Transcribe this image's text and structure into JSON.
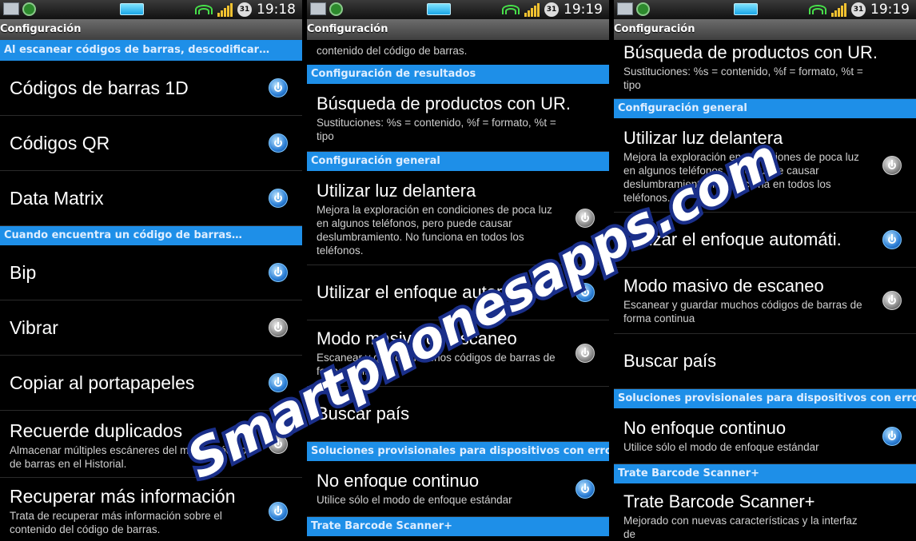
{
  "status": {
    "time": "19:18",
    "time2": "19:19",
    "cal": "31"
  },
  "title": "Configuración",
  "watermark": "Smartphonesapps.com",
  "panel1": {
    "cat1": "Al escanear códigos de barras, descodificar…",
    "row1": "Códigos de barras 1D",
    "row2": "Códigos QR",
    "row3": "Data Matrix",
    "cat2": "Cuando encuentra un código de barras…",
    "row4": "Bip",
    "row5": "Vibrar",
    "row6": "Copiar al portapapeles",
    "row7": "Recuerde duplicados",
    "row7_sum": "Almacenar múltiples escáneres del mismo código de barras en el Historial.",
    "row8": "Recuperar más información",
    "row8_sum": "Trata de recuperar más información sobre el contenido del código de barras."
  },
  "panel2": {
    "top_sum": "contenido del código de barras.",
    "cat1": "Configuración de resultados",
    "row1": "Búsqueda de productos con UR.",
    "row1_sum": "Sustituciones: %s = contenido, %f = formato, %t = tipo",
    "cat2": "Configuración general",
    "row2": "Utilizar luz delantera",
    "row2_sum": "Mejora la exploración en condiciones de poca luz en algunos teléfonos, pero puede causar deslumbramiento. No funciona en todos los teléfonos.",
    "row3": "Utilizar el enfoque automáti.",
    "row4": "Modo masivo de escaneo",
    "row4_sum": "Escanear y guardar muchos códigos de barras de forma continua",
    "row5": "Buscar país",
    "cat3": "Soluciones provisionales para dispositivos con errores",
    "row6": "No enfoque continuo",
    "row6_sum": "Utilice sólo el modo de enfoque estándar",
    "cat4": "Trate Barcode Scanner+"
  },
  "panel3": {
    "row1": "Búsqueda de productos con UR.",
    "row1_sum": "Sustituciones: %s = contenido, %f = formato, %t = tipo",
    "cat1": "Configuración general",
    "row2": "Utilizar luz delantera",
    "row2_sum": "Mejora la exploración en condiciones de poca luz en algunos teléfonos, pero puede causar deslumbramiento. No funciona en todos los teléfonos.",
    "row3": "Utilizar el enfoque automáti.",
    "row4": "Modo masivo de escaneo",
    "row4_sum": "Escanear y guardar muchos códigos de barras de forma continua",
    "row5": "Buscar país",
    "cat2": "Soluciones provisionales para dispositivos con errores",
    "row6": "No enfoque continuo",
    "row6_sum": "Utilice sólo el modo de enfoque estándar",
    "cat3": "Trate Barcode Scanner+",
    "row7": "Trate Barcode Scanner+",
    "row7_sum": "Mejorado con nuevas características y la interfaz de"
  }
}
